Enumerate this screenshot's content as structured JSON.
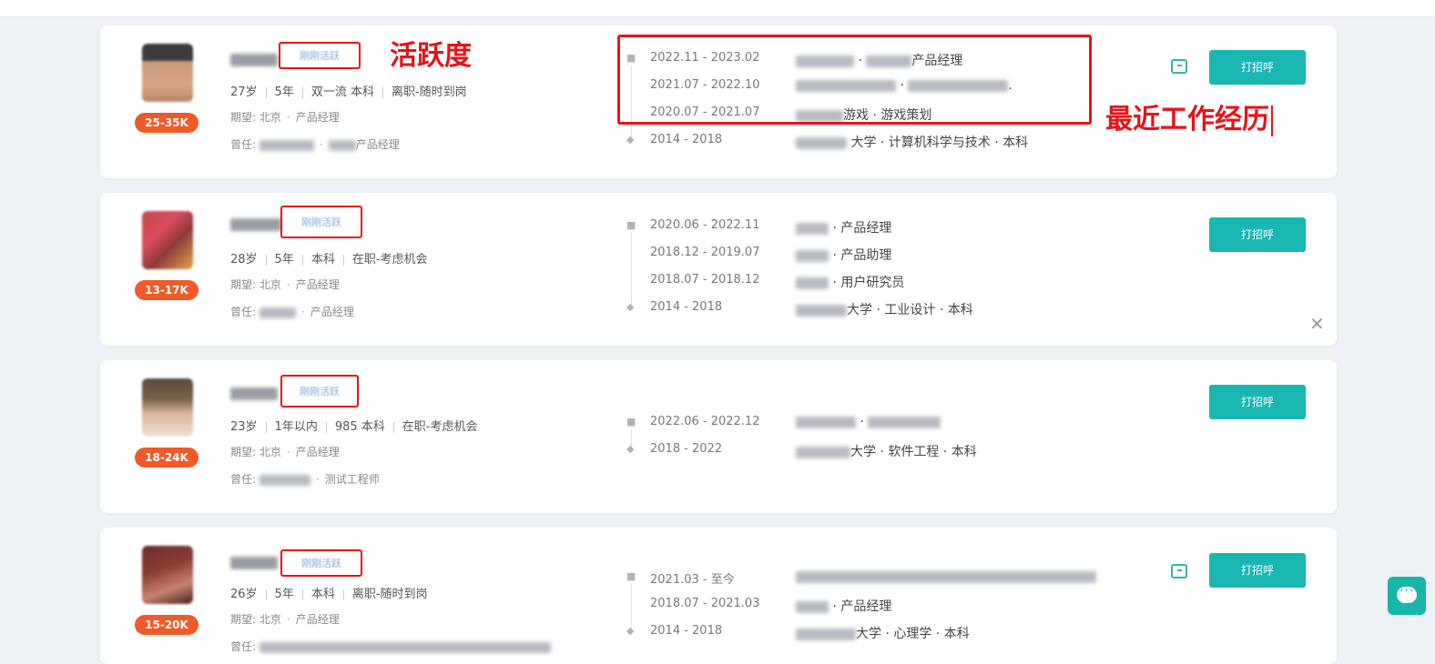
{
  "annotations": {
    "activity_label": "活跃度",
    "recent_work_label": "最近工作经历"
  },
  "candidates": [
    {
      "salary": "25-35K",
      "active_status": "刚刚活跃",
      "age": "27岁",
      "years": "5年",
      "education": "双一流 本科",
      "job_status": "离职-随时到岗",
      "expect_prefix": "期望:",
      "expect_city": "北京",
      "expect_role": "产品经理",
      "prev_prefix": "曾任:",
      "prev_role": "产品经理",
      "experience": [
        {
          "date": "2022.11 - 2023.02",
          "desc": "产品经理"
        },
        {
          "date": "2021.07 - 2022.10",
          "desc": "."
        },
        {
          "date": "2020.07 - 2021.07",
          "desc": "游戏 · 游戏策划"
        }
      ],
      "education_row": {
        "date": "2014 - 2018",
        "desc": "大学 · 计算机科学与技术 · 本科"
      },
      "button": "打招呼"
    },
    {
      "salary": "13-17K",
      "active_status": "刚刚活跃",
      "age": "28岁",
      "years": "5年",
      "education": "本科",
      "job_status": "在职-考虑机会",
      "expect_prefix": "期望:",
      "expect_city": "北京",
      "expect_role": "产品经理",
      "prev_prefix": "曾任:",
      "prev_role": "产品经理",
      "experience": [
        {
          "date": "2020.06 - 2022.11",
          "desc": "产品经理"
        },
        {
          "date": "2018.12 - 2019.07",
          "desc": "产品助理"
        },
        {
          "date": "2018.07 - 2018.12",
          "desc": "用户研究员"
        }
      ],
      "education_row": {
        "date": "2014 - 2018",
        "desc": "大学 · 工业设计 · 本科"
      },
      "button": "打招呼"
    },
    {
      "salary": "18-24K",
      "active_status": "刚刚活跃",
      "age": "23岁",
      "years": "1年以内",
      "education": "985 本科",
      "job_status": "在职-考虑机会",
      "expect_prefix": "期望:",
      "expect_city": "北京",
      "expect_role": "产品经理",
      "prev_prefix": "曾任:",
      "prev_role": "测试工程师",
      "experience": [
        {
          "date": "2022.06 - 2022.12",
          "desc": ""
        }
      ],
      "education_row": {
        "date": "2018 - 2022",
        "desc": "大学 · 软件工程 · 本科"
      },
      "button": "打招呼"
    },
    {
      "salary": "15-20K",
      "active_status": "刚刚活跃",
      "age": "26岁",
      "years": "5年",
      "education": "本科",
      "job_status": "离职-随时到岗",
      "expect_prefix": "期望:",
      "expect_city": "北京",
      "expect_role": "产品经理",
      "prev_prefix": "曾任:",
      "prev_role": "",
      "experience": [
        {
          "date": "2021.03 - 至今",
          "desc": ""
        },
        {
          "date": "2018.07 - 2021.03",
          "desc": "产品经理"
        }
      ],
      "education_row": {
        "date": "2014 - 2018",
        "desc": "大学 · 心理学 · 本科"
      },
      "button": "打招呼"
    }
  ],
  "colors": {
    "accent": "#19b6b2",
    "salary_badge": "#f05a28",
    "annotation_red": "#e8121a"
  },
  "icons": [
    "briefcase-icon",
    "graduation-cap-icon",
    "chat-icon",
    "close-icon",
    "chat-bubble-icon"
  ]
}
